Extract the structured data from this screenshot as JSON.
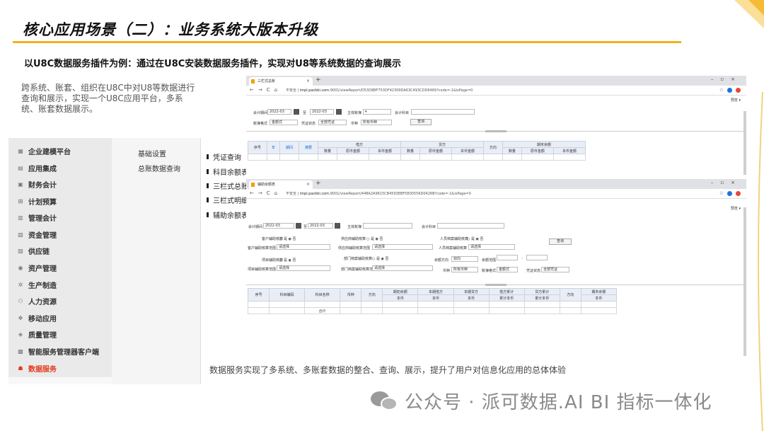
{
  "slide": {
    "title": "核心应用场景（二）：业务系统大版本升级",
    "subtitle": "以U8C数据服务插件为例：通过在U8C安装数据服务插件，实现对U8等系统数据的查询展示",
    "description": "跨系统、账套、组织在U8C中对U8等数据进行查询和展示，实现一个U8C应用平台，多系统、账套数据展示。",
    "bottom_note": "数据服务实现了多系统、多账套数据的整合、查询、展示，提升了用户对信息化应用的总体体验",
    "watermark": "公众号 · 派可数据.AI BI 指标一体化",
    "accent_color": "#f2b21b"
  },
  "menu": {
    "items": [
      {
        "label": "企业建模平台",
        "icon": "building-icon"
      },
      {
        "label": "应用集成",
        "icon": "grid-icon"
      },
      {
        "label": "财务会计",
        "icon": "ledger-icon"
      },
      {
        "label": "计划预算",
        "icon": "calc-icon"
      },
      {
        "label": "管理会计",
        "icon": "chart-icon"
      },
      {
        "label": "资金管理",
        "icon": "money-icon"
      },
      {
        "label": "供应链",
        "icon": "chain-icon"
      },
      {
        "label": "资产管理",
        "icon": "asset-icon"
      },
      {
        "label": "生产制造",
        "icon": "gear-icon"
      },
      {
        "label": "人力资源",
        "icon": "people-icon"
      },
      {
        "label": "移动应用",
        "icon": "mobile-icon"
      },
      {
        "label": "质量管理",
        "icon": "shield-icon"
      },
      {
        "label": "智能服务管理器客户端",
        "icon": "client-icon"
      },
      {
        "label": "数据服务",
        "icon": "data-icon",
        "active": true
      }
    ],
    "sub_items": [
      "基础设置",
      "总账数据查询"
    ],
    "groups": [
      "凭证查询",
      "科目余额表",
      "三栏式总账",
      "三栏式明细账",
      "辅助余额表"
    ]
  },
  "browser1": {
    "tab": "三栏式总账",
    "url_prefix": "不安全 | ",
    "url_domain": "impl.packbi.com",
    "url_rest": ":9001/viewReport/D53D8BF753DF42309DA63C493CDD6469?code=-1&isPage=0",
    "preview": "预览 ▾",
    "form": {
      "period_label": "会计期间",
      "period_from": "2022-03",
      "period_to": "2022-03",
      "book_label": "主体账簿",
      "subject_label": "会计科目",
      "format_label": "账簿格式",
      "format_value": "金额式",
      "status_label": "凭证状态",
      "status_value": "全部凭证",
      "currency_label": "币种",
      "currency_value": "所有币种",
      "query_btn": "查询"
    },
    "table": {
      "top_headers": [
        "序号",
        "年",
        "期间",
        "摘要",
        "借方",
        "贷方",
        "方向",
        "期末余额"
      ],
      "sub_headers": [
        "数量",
        "原币金额",
        "本币金额",
        "数量",
        "原币金额",
        "本币金额",
        "数量",
        "原币金额",
        "本币金额"
      ]
    }
  },
  "browser2": {
    "tab": "辅助余额表",
    "url_prefix": "不安全 | ",
    "url_domain": "impl.packbi.com",
    "url_rest": ":9001/viewReport/448A2A9615CB4593EBF5E00556D0426B?code=-1&isPage=0",
    "preview": "预览 ▾",
    "form": {
      "period_label": "会计期间",
      "period_from": "2022-03",
      "period_to": "2022-03",
      "book_label": "主体账簿",
      "subject_label": "会计科目",
      "customer_aux_label": "客户辅助核算",
      "supplier_aux_label": "供应商辅助核算",
      "staff_aux_label": "人员档案辅助核算",
      "customer_range_label": "客户辅助核算范围",
      "supplier_range_label": "供应商辅助核算范围",
      "staff_range_label": "人员档案辅助核算",
      "project_aux_label": "项目辅助核算",
      "dept_aux_label": "部门档案辅助核算",
      "project_range_label": "项目辅助核算范围",
      "dept_range_label": "部门档案辅助核算范围",
      "select_placeholder": "请选择",
      "yes": "是",
      "no": "否",
      "balance_dir_label": "余额方向",
      "balance_dir_value": "双向",
      "balance_range_label": "余额范围",
      "currency_label": "币种",
      "currency_value": "所有币种",
      "format_label": "账簿格式",
      "format_value": "金额式",
      "status_label": "凭证状态",
      "status_value": "全部凭证",
      "query_btn": "查询"
    },
    "table": {
      "top_headers": [
        "序号",
        "科目编码",
        "科目名称",
        "币种",
        "方向",
        "期初余额",
        "本期借方",
        "本期贷方",
        "借方累计",
        "贷方累计",
        "方向",
        "期末余额"
      ],
      "sub_headers": [
        "本币",
        "本币",
        "本币",
        "累计本币",
        "累计本币",
        "本币"
      ],
      "total_label": "合计"
    }
  }
}
